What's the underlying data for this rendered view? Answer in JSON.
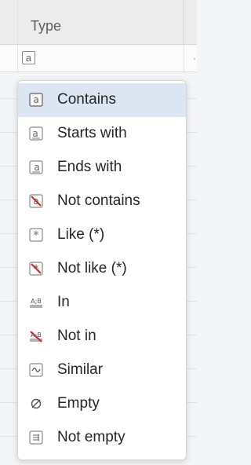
{
  "header": {
    "column_title": "Type"
  },
  "filter_row": {
    "operator_icon": "text-contains-icon",
    "operator_glyph": "a"
  },
  "menu": {
    "items": [
      {
        "label": "Contains",
        "icon": "contains-icon",
        "active": true
      },
      {
        "label": "Starts with",
        "icon": "starts-with-icon",
        "active": false
      },
      {
        "label": "Ends with",
        "icon": "ends-with-icon",
        "active": false
      },
      {
        "label": "Not contains",
        "icon": "not-contains-icon",
        "active": false
      },
      {
        "label": "Like (*)",
        "icon": "like-icon",
        "active": false
      },
      {
        "label": "Not like (*)",
        "icon": "not-like-icon",
        "active": false
      },
      {
        "label": "In",
        "icon": "in-icon",
        "active": false
      },
      {
        "label": "Not in",
        "icon": "not-in-icon",
        "active": false
      },
      {
        "label": "Similar",
        "icon": "similar-icon",
        "active": false
      },
      {
        "label": "Empty",
        "icon": "empty-icon",
        "active": false
      },
      {
        "label": "Not empty",
        "icon": "not-empty-icon",
        "active": false
      }
    ]
  }
}
